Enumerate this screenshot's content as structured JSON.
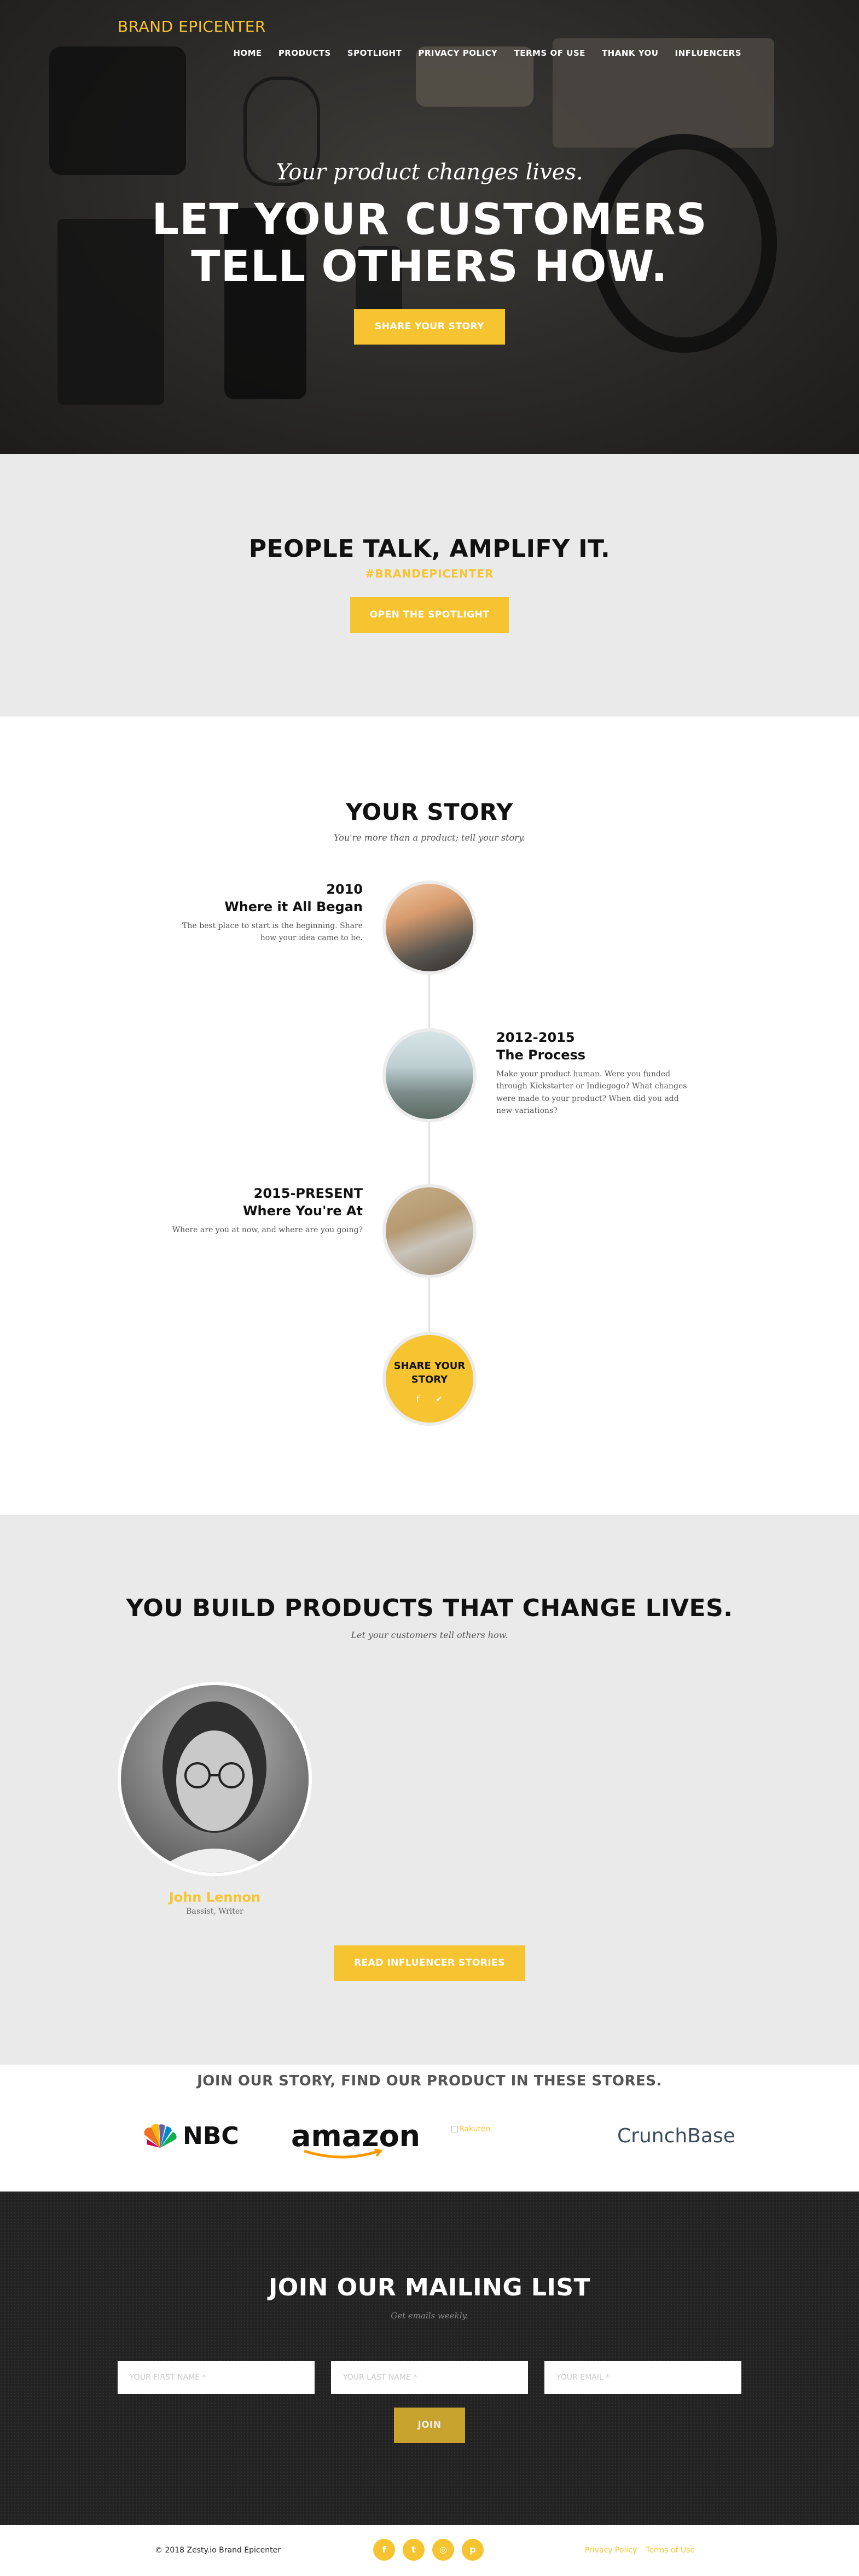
{
  "header": {
    "brand": "BRAND EPICENTER",
    "nav": [
      "HOME",
      "PRODUCTS",
      "SPOTLIGHT",
      "PRIVACY POLICY",
      "TERMS OF USE",
      "THANK YOU",
      "INFLUENCERS"
    ]
  },
  "hero": {
    "subtitle": "Your product changes lives.",
    "title": "LET YOUR CUSTOMERS TELL OTHERS HOW.",
    "button": "SHARE YOUR STORY"
  },
  "talk": {
    "title": "PEOPLE TALK, AMPLIFY IT.",
    "hashtag": "#BRANDEPICENTER",
    "button": "OPEN THE SPOTLIGHT"
  },
  "story": {
    "title": "YOUR STORY",
    "subtitle": "You're more than a product; tell your story.",
    "items": [
      {
        "year": "2010",
        "heading": "Where it All Began",
        "text": "The best place to start is the beginning. Share how your idea came to be."
      },
      {
        "year": "2012-2015",
        "heading": "The Process",
        "text": "Make your product human. Were you funded through Kickstarter or Indiegogo? What changes were made to your product? When did you add new variations?"
      },
      {
        "year": "2015-PRESENT",
        "heading": "Where You're At",
        "text": "Where are you at now, and where are you going?"
      }
    ],
    "share_label": "SHARE YOUR STORY"
  },
  "build": {
    "title": "YOU BUILD PRODUCTS THAT CHANGE LIVES.",
    "subtitle": "Let your customers tell others how.",
    "influencer_name": "John Lennon",
    "influencer_role": "Bassist, Writer",
    "button": "READ INFLUENCER STORIES"
  },
  "stores": {
    "title": "JOIN OUR STORY, FIND OUR PRODUCT IN THESE STORES.",
    "logos": [
      "NBC",
      "amazon",
      "Rakuten",
      "CrunchBase"
    ]
  },
  "mailing": {
    "title": "JOIN OUR MAILING LIST",
    "subtitle": "Get emails weekly.",
    "first_placeholder": "YOUR FIRST NAME *",
    "last_placeholder": "YOUR LAST NAME *",
    "email_placeholder": "YOUR EMAIL *",
    "button": "JOIN"
  },
  "footer": {
    "copyright": "© 2018 Zesty.io Brand Epicenter",
    "links": [
      "Privacy Policy",
      "Terms of Use"
    ]
  },
  "colors": {
    "accent": "#f6c430",
    "dark": "#232323",
    "light": "#eaeaea"
  }
}
